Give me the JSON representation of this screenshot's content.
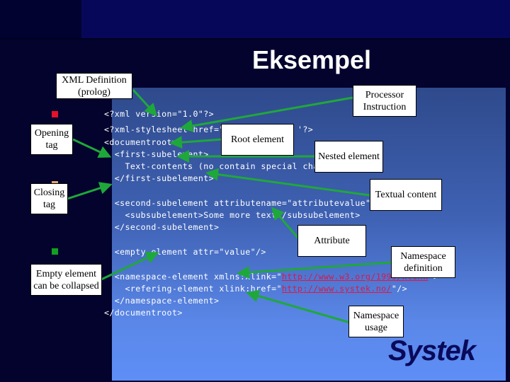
{
  "slide": {
    "title": "Eksempel",
    "logo_text": "Systek"
  },
  "code": {
    "lines": [
      "<?xml version=\"1.0\"?>",
      "<?xml-stylesheet href=\"",
      "'?>",
      "<documentroot>",
      "  <first-subelement>",
      "    Text-contents (no contain special char",
      "  </first-subelement>",
      "  <second-subelement attributename=\"attributevalue\">",
      "    <subsubelement>Some more text</subsubelement>",
      "  </second-subelement>",
      "  <empty-element attr=\"value\"/>",
      "  <namespace-element xmlns:xlink=\"",
      "http://www.w3.org/1999/xlink",
      "\">",
      "    <refering-element xlink:href=\"",
      "http://www.systek.no/",
      "\"/>",
      "  </namespace-element>",
      "</documentroot>"
    ]
  },
  "callouts": {
    "xml_definition": "XML Definition (prolog)",
    "processor_instruction": "Processor Instruction",
    "root_element": "Root element",
    "opening_tag": "Opening tag",
    "nested_element": "Nested element",
    "closing_tag": "Closing tag",
    "textual_content": "Textual content",
    "attribute": "Attribute",
    "empty_element": "Empty element can be collapsed",
    "namespace_definition": "Namespace definition",
    "namespace_usage": "Namespace usage"
  },
  "colors": {
    "background": "#03032e",
    "top_band": "#07075a",
    "arrow": "#1fa83a",
    "bullet_red": "#e8102a",
    "bullet_orange": "#e8a070",
    "bullet_green": "#12a020",
    "link": "#d8194a"
  }
}
